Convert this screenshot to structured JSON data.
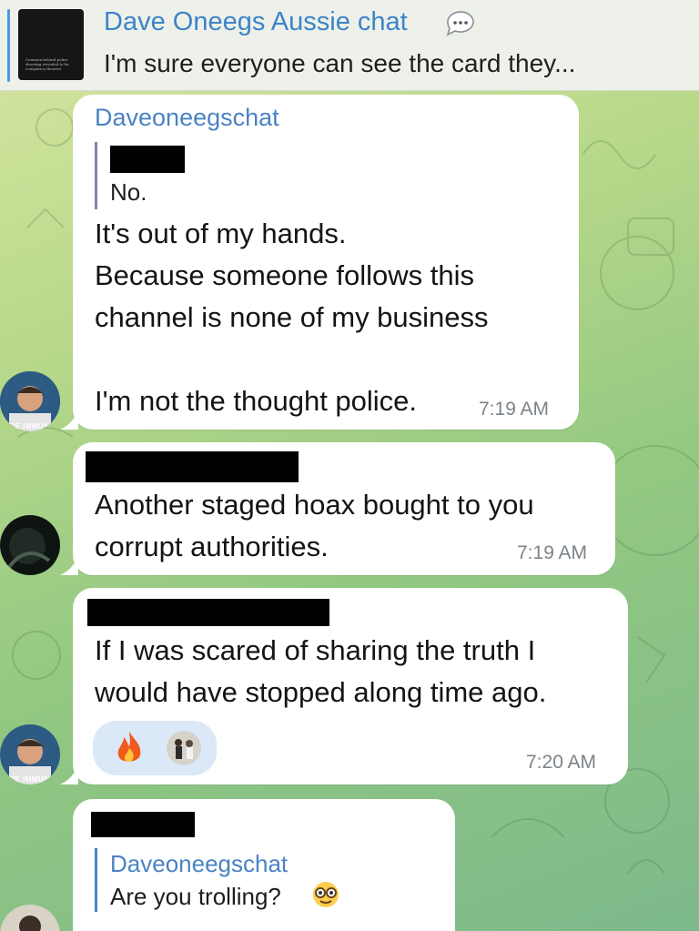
{
  "header": {
    "title": "Dave Oneegs Aussie chat",
    "subtitle": "I'm sure everyone can see the card they...",
    "thumbnail_caption": "Common behind police shooting revealed to be conspiracy theorist"
  },
  "messages": [
    {
      "sender": "Daveoneegschat",
      "reply_text": "No.",
      "text": "It's out of my hands.\nBecause someone follows this\nchannel is none of my business\n\nI'm not the thought police.",
      "time": "7:19 AM",
      "avatar_caption": "ARE IMMUNE"
    },
    {
      "text": "Another staged hoax bought to you\ncorrupt authorities.",
      "time": "7:19 AM"
    },
    {
      "text": "If I was scared of sharing the truth I\nwould have stopped along time ago.",
      "time": "7:20 AM",
      "avatar_caption": "ARE IMMUNE",
      "reactions": [
        "fire",
        "photo-avatar"
      ]
    },
    {
      "reply_sender": "Daveoneegschat",
      "reply_text": "Are you trolling?"
    }
  ],
  "colors": {
    "accent": "#4a83c4",
    "bubble": "#ffffff",
    "header_bg": "#eef1ea",
    "reply_bar": "#8d7db8"
  }
}
